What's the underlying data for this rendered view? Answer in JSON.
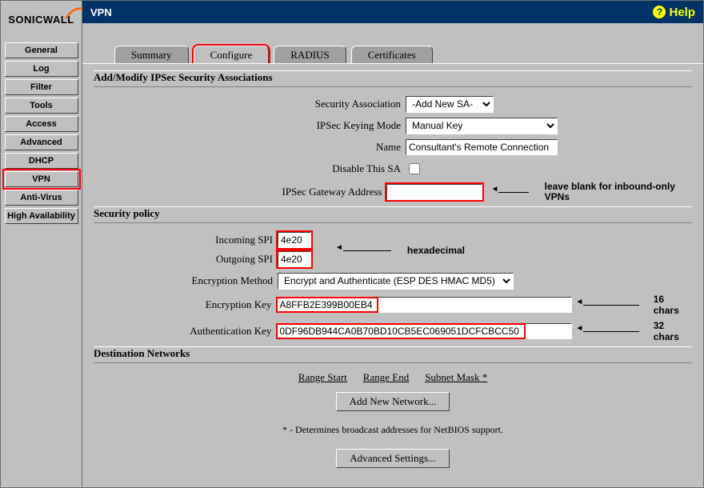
{
  "brand": "SONICWALL",
  "titlebar": {
    "title": "VPN",
    "help": "Help",
    "help_q": "?"
  },
  "nav": {
    "items": [
      {
        "label": "General"
      },
      {
        "label": "Log"
      },
      {
        "label": "Filter"
      },
      {
        "label": "Tools"
      },
      {
        "label": "Access"
      },
      {
        "label": "Advanced"
      },
      {
        "label": "DHCP"
      },
      {
        "label": "VPN"
      },
      {
        "label": "Anti-Virus"
      },
      {
        "label": "High Availability"
      }
    ],
    "selected_index": 7
  },
  "tabs": {
    "items": [
      "Summary",
      "Configure",
      "RADIUS",
      "Certificates"
    ],
    "active_index": 1
  },
  "sections": {
    "addmod": "Add/Modify IPSec Security Associations",
    "secpol": "Security policy",
    "dest": "Destination Networks"
  },
  "fields": {
    "security_association": {
      "label": "Security Association",
      "value": "-Add New SA-"
    },
    "ipsec_keying_mode": {
      "label": "IPSec Keying Mode",
      "value": "Manual Key"
    },
    "name": {
      "label": "Name",
      "value": "Consultant's Remote Connection"
    },
    "disable_sa": {
      "label": "Disable This SA",
      "checked": false
    },
    "gateway": {
      "label": "IPSec Gateway Address",
      "value": ""
    },
    "incoming_spi": {
      "label": "Incoming SPI",
      "value": "4e20"
    },
    "outgoing_spi": {
      "label": "Outgoing SPI",
      "value": "4e20"
    },
    "encryption_method": {
      "label": "Encryption Method",
      "value": "Encrypt and Authenticate (ESP DES HMAC MD5)"
    },
    "encryption_key": {
      "label": "Encryption Key",
      "value": "A8FFB2E399B00EB4"
    },
    "authentication_key": {
      "label": "Authentication Key",
      "value": "0DF96DB944CA0B70BD10CB5EC069051DCFCBCC50"
    }
  },
  "dest_headers": {
    "range_start": "Range Start",
    "range_end": "Range End",
    "subnet": "Subnet Mask *"
  },
  "buttons": {
    "add_network": "Add New Network...",
    "advanced": "Advanced Settings..."
  },
  "note": "* - Determines broadcast addresses for NetBIOS support.",
  "annotations": {
    "gateway_note": "leave blank for inbound-only VPNs",
    "spi_note": "hexadecimal",
    "enc_key_note": "16 chars",
    "auth_key_note": "32 chars"
  }
}
